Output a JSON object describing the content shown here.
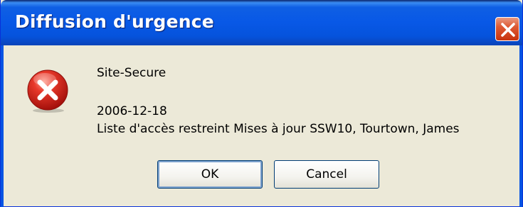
{
  "window": {
    "title": "Diffusion d'urgence"
  },
  "titlebar": {
    "close_icon": "close-icon",
    "close_color": "#de5a33"
  },
  "message": {
    "icon": "error-icon",
    "app_name": "Site-Secure",
    "date": "2006-12-18",
    "body": "Liste d'accès restreint Mises à jour SSW10, Tourtown, James"
  },
  "buttons": {
    "ok_label": "OK",
    "cancel_label": "Cancel"
  },
  "colors": {
    "titlebar": "#0858e6",
    "dialog_background": "#ece9d8",
    "error_red": "#d9281f"
  }
}
